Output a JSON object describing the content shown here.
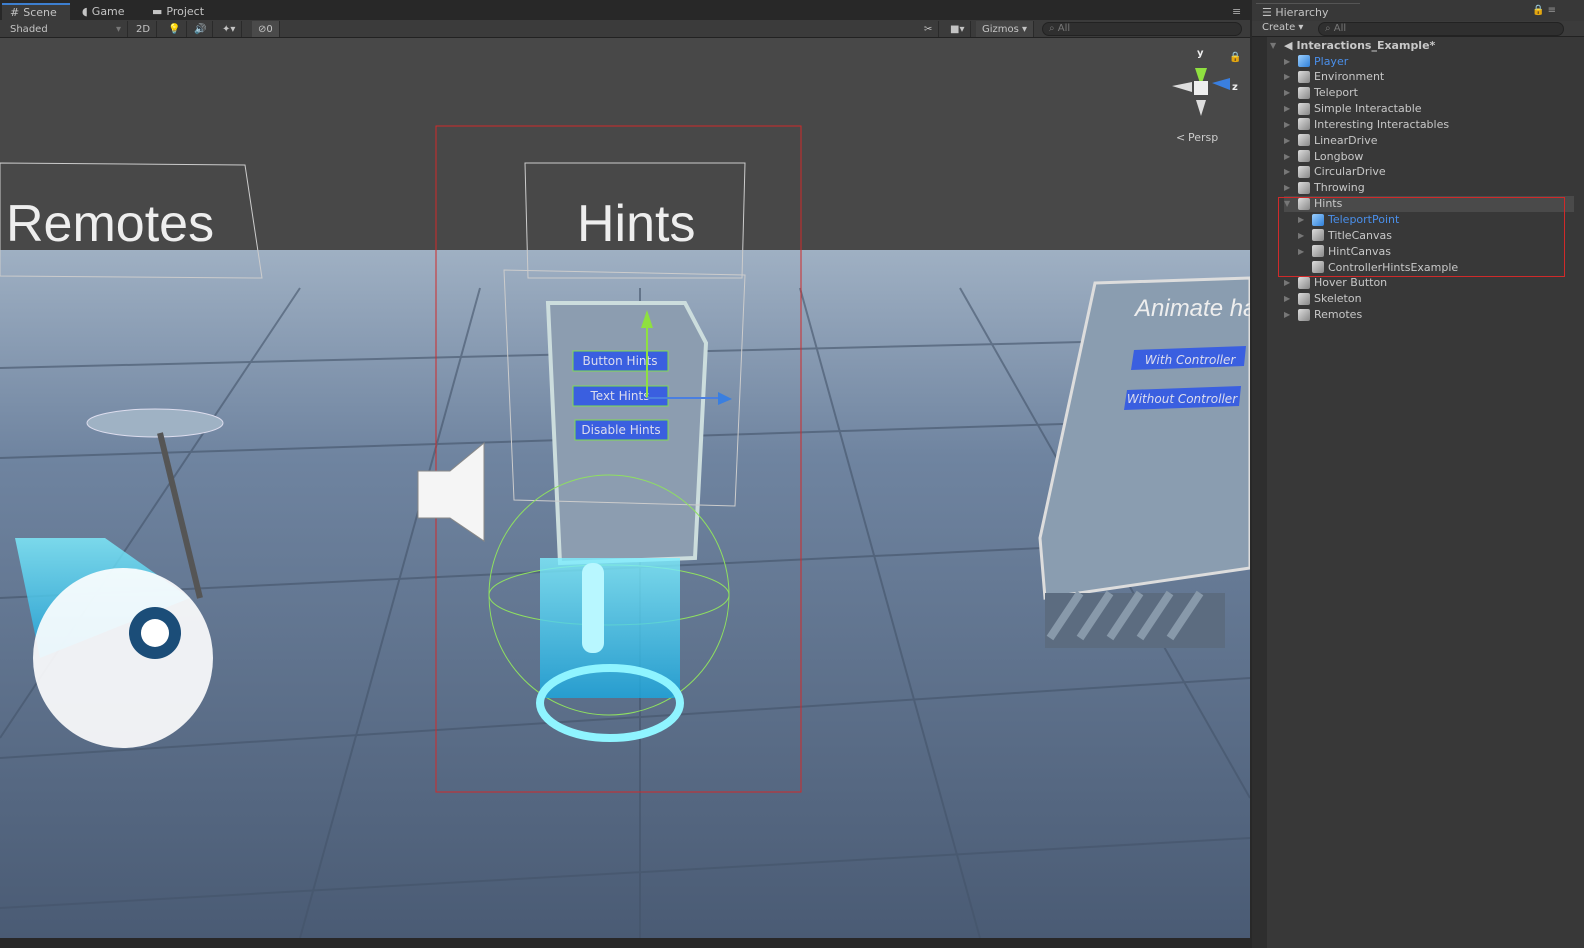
{
  "tabs": [
    {
      "label": "Scene",
      "icon": "grid-icon"
    },
    {
      "label": "Game",
      "icon": "pacman-icon"
    },
    {
      "label": "Project",
      "icon": "folder-icon"
    }
  ],
  "toolbar": {
    "shading": "Shaded",
    "mode2d": "2D",
    "hidden_count": "0",
    "gizmos": "Gizmos",
    "search_placeholder": "All"
  },
  "scene": {
    "titles": {
      "remotes": "Remotes",
      "hints": "Hints",
      "animate": "Animate ha"
    },
    "hint_buttons": [
      "Button Hints",
      "Text Hints",
      "Disable Hints"
    ],
    "animate_buttons": [
      "With Controller",
      "Without Controller"
    ],
    "gizmo": {
      "y": "y",
      "z": "z",
      "projection": "Persp"
    },
    "colors": {
      "selection": "#d02a2a",
      "sky": "#484848",
      "floor": "#5a6e88",
      "button": "#3a5fe0"
    }
  },
  "hierarchy": {
    "tab": "Hierarchy",
    "create": "Create",
    "search_placeholder": "All",
    "scene_name": "Interactions_Example*",
    "items": [
      {
        "label": "Player",
        "depth": 1,
        "expand": true,
        "prefab": true
      },
      {
        "label": "Environment",
        "depth": 1,
        "expand": true
      },
      {
        "label": "Teleport",
        "depth": 1,
        "expand": true
      },
      {
        "label": "Simple Interactable",
        "depth": 1,
        "expand": true
      },
      {
        "label": "Interesting Interactables",
        "depth": 1,
        "expand": true
      },
      {
        "label": "LinearDrive",
        "depth": 1,
        "expand": true
      },
      {
        "label": "Longbow",
        "depth": 1,
        "expand": true
      },
      {
        "label": "CircularDrive",
        "depth": 1,
        "expand": true
      },
      {
        "label": "Throwing",
        "depth": 1,
        "expand": true
      },
      {
        "label": "Hints",
        "depth": 1,
        "expand": true,
        "open": true,
        "selected": true
      },
      {
        "label": "TeleportPoint",
        "depth": 2,
        "expand": true,
        "prefab": true
      },
      {
        "label": "TitleCanvas",
        "depth": 2,
        "expand": true
      },
      {
        "label": "HintCanvas",
        "depth": 2,
        "expand": true
      },
      {
        "label": "ControllerHintsExample",
        "depth": 2,
        "expand": false
      },
      {
        "label": "Hover Button",
        "depth": 1,
        "expand": true
      },
      {
        "label": "Skeleton",
        "depth": 1,
        "expand": true
      },
      {
        "label": "Remotes",
        "depth": 1,
        "expand": true
      }
    ]
  }
}
